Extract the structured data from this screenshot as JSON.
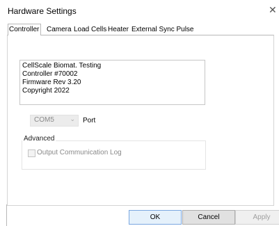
{
  "window": {
    "title": "Hardware Settings",
    "close_glyph": "✕"
  },
  "tabs": [
    {
      "label": "Controller",
      "active": true
    },
    {
      "label": "Camera",
      "active": false
    },
    {
      "label": "Load Cells",
      "active": false
    },
    {
      "label": "Heater",
      "active": false
    },
    {
      "label": "External Sync Pulse",
      "active": false
    }
  ],
  "info_lines": [
    "CellScale Biomat. Testing",
    "Controller #70002",
    "Firmware Rev 3.20",
    "Copyright 2022"
  ],
  "port": {
    "selected": "COM5",
    "label": "Port",
    "chevron_icon": "chevron-down-icon"
  },
  "advanced": {
    "legend": "Advanced",
    "checkbox_label": "Output Communication Log",
    "checked": false,
    "disabled": true
  },
  "buttons": {
    "ok": "OK",
    "cancel": "Cancel",
    "apply": "Apply"
  }
}
